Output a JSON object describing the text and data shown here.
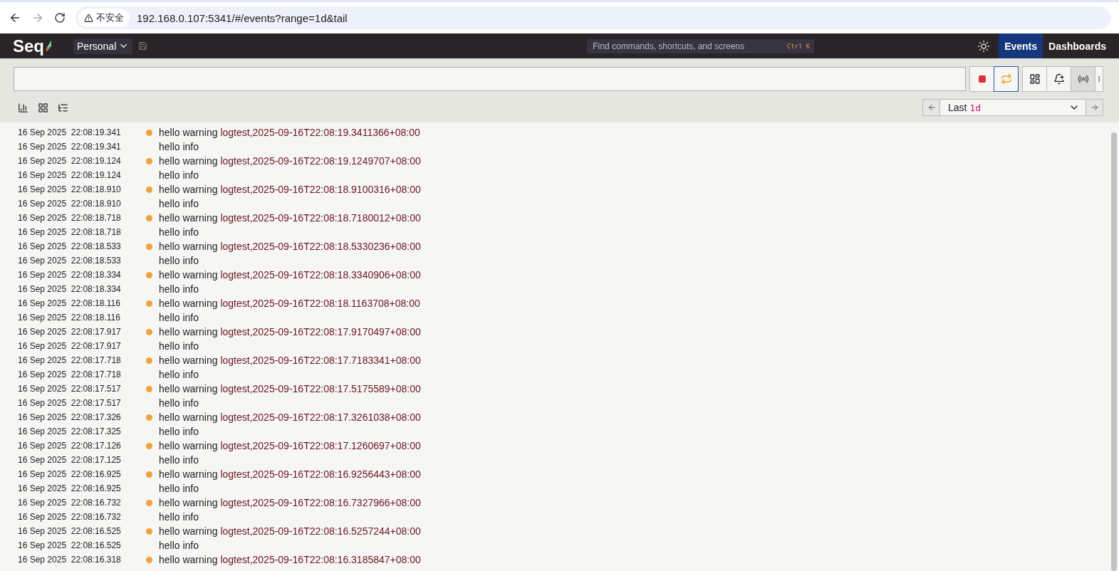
{
  "browser": {
    "security_label": "不安全",
    "url": "192.168.0.107:5341/#/events?range=1d&tail"
  },
  "header": {
    "logo": "Seq",
    "workspace": "Personal",
    "search": {
      "placeholder": "Find commands, shortcuts, and screens",
      "shortcut": "Ctrl K"
    },
    "nav": [
      {
        "label": "Events",
        "selected": true
      },
      {
        "label": "Dashboards",
        "selected": false
      }
    ]
  },
  "toolbar": {
    "tail_active": true,
    "range": {
      "prefix": "Last",
      "value": "1d"
    }
  },
  "events": [
    {
      "time": "16 Sep 2025  22:08:19.341",
      "kind": "warning",
      "message": "hello warning",
      "value": "logtest,2025-09-16T22:08:19.3411366+08:00"
    },
    {
      "time": "16 Sep 2025  22:08:19.341",
      "kind": "info",
      "message": "hello info"
    },
    {
      "time": "16 Sep 2025  22:08:19.124",
      "kind": "warning",
      "message": "hello warning",
      "value": "logtest,2025-09-16T22:08:19.1249707+08:00"
    },
    {
      "time": "16 Sep 2025  22:08:19.124",
      "kind": "info",
      "message": "hello info"
    },
    {
      "time": "16 Sep 2025  22:08:18.910",
      "kind": "warning",
      "message": "hello warning",
      "value": "logtest,2025-09-16T22:08:18.9100316+08:00"
    },
    {
      "time": "16 Sep 2025  22:08:18.910",
      "kind": "info",
      "message": "hello info"
    },
    {
      "time": "16 Sep 2025  22:08:18.718",
      "kind": "warning",
      "message": "hello warning",
      "value": "logtest,2025-09-16T22:08:18.7180012+08:00"
    },
    {
      "time": "16 Sep 2025  22:08:18.718",
      "kind": "info",
      "message": "hello info"
    },
    {
      "time": "16 Sep 2025  22:08:18.533",
      "kind": "warning",
      "message": "hello warning",
      "value": "logtest,2025-09-16T22:08:18.5330236+08:00"
    },
    {
      "time": "16 Sep 2025  22:08:18.533",
      "kind": "info",
      "message": "hello info"
    },
    {
      "time": "16 Sep 2025  22:08:18.334",
      "kind": "warning",
      "message": "hello warning",
      "value": "logtest,2025-09-16T22:08:18.3340906+08:00"
    },
    {
      "time": "16 Sep 2025  22:08:18.334",
      "kind": "info",
      "message": "hello info"
    },
    {
      "time": "16 Sep 2025  22:08:18.116",
      "kind": "warning",
      "message": "hello warning",
      "value": "logtest,2025-09-16T22:08:18.1163708+08:00"
    },
    {
      "time": "16 Sep 2025  22:08:18.116",
      "kind": "info",
      "message": "hello info"
    },
    {
      "time": "16 Sep 2025  22:08:17.917",
      "kind": "warning",
      "message": "hello warning",
      "value": "logtest,2025-09-16T22:08:17.9170497+08:00"
    },
    {
      "time": "16 Sep 2025  22:08:17.917",
      "kind": "info",
      "message": "hello info"
    },
    {
      "time": "16 Sep 2025  22:08:17.718",
      "kind": "warning",
      "message": "hello warning",
      "value": "logtest,2025-09-16T22:08:17.7183341+08:00"
    },
    {
      "time": "16 Sep 2025  22:08:17.718",
      "kind": "info",
      "message": "hello info"
    },
    {
      "time": "16 Sep 2025  22:08:17.517",
      "kind": "warning",
      "message": "hello warning",
      "value": "logtest,2025-09-16T22:08:17.5175589+08:00"
    },
    {
      "time": "16 Sep 2025  22:08:17.517",
      "kind": "info",
      "message": "hello info"
    },
    {
      "time": "16 Sep 2025  22:08:17.326",
      "kind": "warning",
      "message": "hello warning",
      "value": "logtest,2025-09-16T22:08:17.3261038+08:00"
    },
    {
      "time": "16 Sep 2025  22:08:17.325",
      "kind": "info",
      "message": "hello info"
    },
    {
      "time": "16 Sep 2025  22:08:17.126",
      "kind": "warning",
      "message": "hello warning",
      "value": "logtest,2025-09-16T22:08:17.1260697+08:00"
    },
    {
      "time": "16 Sep 2025  22:08:17.125",
      "kind": "info",
      "message": "hello info"
    },
    {
      "time": "16 Sep 2025  22:08:16.925",
      "kind": "warning",
      "message": "hello warning",
      "value": "logtest,2025-09-16T22:08:16.9256443+08:00"
    },
    {
      "time": "16 Sep 2025  22:08:16.925",
      "kind": "info",
      "message": "hello info"
    },
    {
      "time": "16 Sep 2025  22:08:16.732",
      "kind": "warning",
      "message": "hello warning",
      "value": "logtest,2025-09-16T22:08:16.7327966+08:00"
    },
    {
      "time": "16 Sep 2025  22:08:16.732",
      "kind": "info",
      "message": "hello info"
    },
    {
      "time": "16 Sep 2025  22:08:16.525",
      "kind": "warning",
      "message": "hello warning",
      "value": "logtest,2025-09-16T22:08:16.5257244+08:00"
    },
    {
      "time": "16 Sep 2025  22:08:16.525",
      "kind": "info",
      "message": "hello info"
    },
    {
      "time": "16 Sep 2025  22:08:16.318",
      "kind": "warning",
      "message": "hello warning",
      "value": "logtest,2025-09-16T22:08:16.3185847+08:00"
    }
  ]
}
